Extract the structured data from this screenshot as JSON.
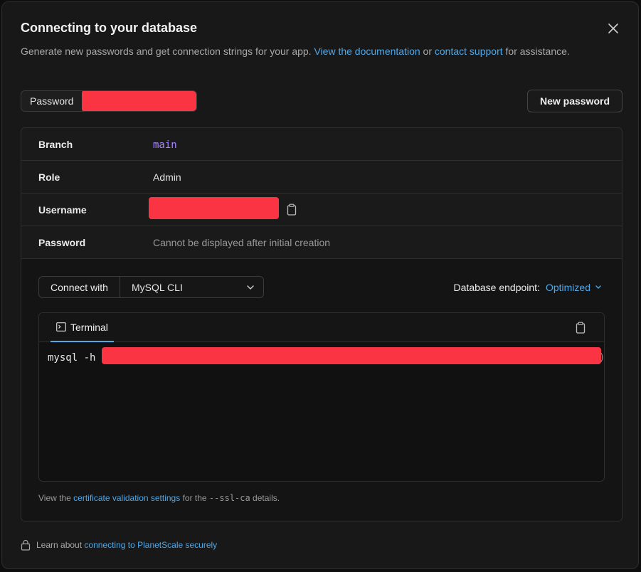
{
  "modal": {
    "title": "Connecting to your database",
    "description": {
      "text_before": "Generate new passwords and get connection strings for your app. ",
      "doc_link": "View the documentation",
      "text_or": " or ",
      "support_link": "contact support",
      "text_after": " for assistance."
    },
    "close_icon": "close-icon"
  },
  "password_chip": {
    "label": "Password",
    "value_redacted": true
  },
  "new_password_button": "New password",
  "details": [
    {
      "label": "Branch",
      "value": "main"
    },
    {
      "label": "Role",
      "value": "Admin"
    },
    {
      "label": "Username",
      "value_redacted": true
    },
    {
      "label": "Password",
      "value": "Cannot be displayed after initial creation"
    }
  ],
  "connect": {
    "label": "Connect with",
    "selected": "MySQL CLI",
    "endpoint_label": "Database endpoint:",
    "endpoint_value": "Optimized"
  },
  "terminal": {
    "tab_label": "Terminal",
    "command_prefix": "mysql -h",
    "command_trailing": ")"
  },
  "cert_note": {
    "text_before": "View the ",
    "link": "certificate validation settings",
    "text_middle": " for the ",
    "code": "--ssl-ca",
    "text_after": " details."
  },
  "footer": {
    "text": "Learn about ",
    "link": "connecting to PlanetScale securely"
  },
  "colors": {
    "accent_link": "#4fa8e8",
    "branch_purple": "#a688ff",
    "redaction": "#fb3444"
  }
}
